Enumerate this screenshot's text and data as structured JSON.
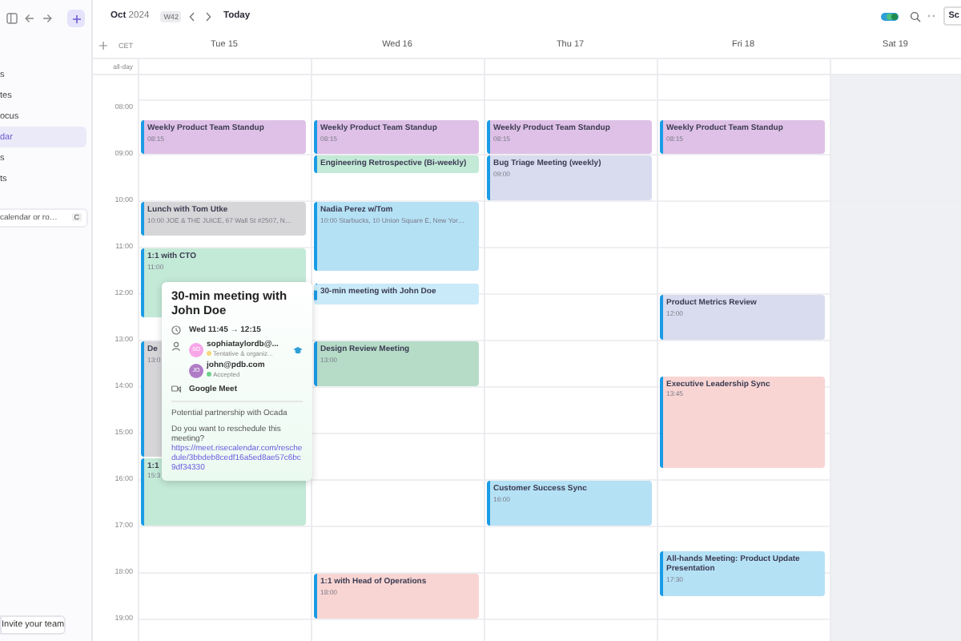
{
  "sidebar": {
    "items": [
      {
        "label": "s",
        "selected": false
      },
      {
        "label": "tes",
        "selected": false
      },
      {
        "label": "ocus",
        "selected": false
      },
      {
        "label": "dar",
        "selected": true
      },
      {
        "label": "s",
        "selected": false
      },
      {
        "label": "ts",
        "selected": false
      }
    ],
    "search": {
      "placeholder": "calendar or ro…",
      "shortcut": "C"
    },
    "invite": "Invite your team"
  },
  "topbar": {
    "month": "Oct",
    "year": "2024",
    "week": "W42",
    "today": "Today",
    "button": "Sc"
  },
  "timezone": "CET",
  "all_day_label": "all-day",
  "hours": [
    "08:00",
    "09:00",
    "10:00",
    "11:00",
    "12:00",
    "13:00",
    "14:00",
    "15:00",
    "16:00",
    "17:00",
    "18:00",
    "19:00"
  ],
  "days": [
    {
      "label": "Tue 15",
      "weekend": false,
      "events": [
        {
          "title": "Weekly Product Team Standup",
          "time": "08:15",
          "color": "#dfc1e7",
          "tentative": false
        },
        {
          "title": "Lunch with Tom Utke",
          "time": "10:00 JOE & THE JUICE, 67 Wall St #2507, N…",
          "color": "#d6d6d8",
          "tentative": false
        },
        {
          "title": "1:1 with CTO",
          "time": "11:00",
          "color": "#c3e9d7",
          "tentative": false
        },
        {
          "title": "De",
          "time": "13:0",
          "color": "#d6d6d8",
          "tentative": false
        },
        {
          "title": "1:1",
          "time": "15:3",
          "color": "#c3e9d7",
          "tentative": false
        }
      ]
    },
    {
      "label": "Wed 16",
      "weekend": false,
      "events": [
        {
          "title": "Weekly Product Team Standup",
          "time": "08:15",
          "color": "#dfc1e7",
          "tentative": false
        },
        {
          "title": "Engineering Retrospective (Bi-weekly)",
          "color": "#c3e9d7",
          "tentative": false
        },
        {
          "title": "Nadia Perez w/Tom",
          "time": "10:00 Starbucks, 10 Union Square E, New Yor…",
          "color": "#b5e1f5",
          "tentative": false
        },
        {
          "title": "30-min meeting with John Doe",
          "color": "#c9eaf9",
          "tentative": true
        },
        {
          "title": "Design Review Meeting",
          "time": "13:00",
          "color": "#b6dcc8",
          "tentative": false
        },
        {
          "title": "1:1 with Head of Operations",
          "time": "18:00",
          "color": "#f8d5d3",
          "tentative": false
        }
      ]
    },
    {
      "label": "Thu 17",
      "weekend": false,
      "events": [
        {
          "title": "Weekly Product Team Standup",
          "time": "08:15",
          "color": "#dfc1e7",
          "tentative": false
        },
        {
          "title": "Bug Triage Meeting (weekly)",
          "time": "09:00",
          "color": "#d9dcee",
          "tentative": false
        },
        {
          "title": "Customer Success Sync",
          "time": "16:00",
          "color": "#b5e1f5",
          "tentative": false
        }
      ]
    },
    {
      "label": "Fri 18",
      "weekend": false,
      "events": [
        {
          "title": "Weekly Product Team Standup",
          "time": "08:15",
          "color": "#dfc1e7",
          "tentative": false
        },
        {
          "title": "Product Metrics Review",
          "time": "12:00",
          "color": "#d9dcee",
          "tentative": false
        },
        {
          "title": "Executive Leadership Sync",
          "time": "13:45",
          "color": "#f8d5d3",
          "tentative": false
        },
        {
          "title": "All-hands Meeting: Product Update Presentation",
          "time": "17:30",
          "color": "#b5e1f5",
          "tentative": false
        }
      ]
    },
    {
      "label": "Sat 19",
      "weekend": true
    }
  ],
  "popup": {
    "title": "30-min meeting with John Doe",
    "day": "Wed",
    "start": "11:45",
    "arrow": "→",
    "end": "12:15",
    "attendees": [
      {
        "initials": "SO",
        "email": "sophiataylordb@...",
        "status": {
          "text": "Tentative & organiz...",
          "color": "#f6d77c"
        },
        "color": "#f7a6e8",
        "organizer": true
      },
      {
        "initials": "JO",
        "email": "john@pdb.com",
        "status": {
          "text": "Accepted",
          "color": "#6fd18a"
        },
        "color": "#b07cc6",
        "organizer": false
      }
    ],
    "location": "Google Meet",
    "description": "Potential partnership with Ocada",
    "question": "Do you want to reschedule this meeting?",
    "link": "https://meet.risecalendar.com/reschedule/3bbdeb8cedf16a5ed8ae57c6bc9df34330"
  }
}
